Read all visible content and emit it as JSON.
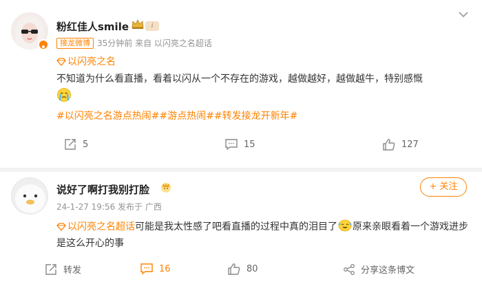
{
  "post1": {
    "username": "粉红佳人smile",
    "source_tag": "接龙微博",
    "time_source": "35分钟前   来自 以闪亮之名超话",
    "topic": "以闪亮之名",
    "text": "不知道为什么看直播，看着以闪从一个不存在的游戏，越做越好，越做越牛，特别感慨",
    "hashtags": "#以闪亮之名游点热闹##游点热闹##转发接龙开新年#",
    "actions": {
      "repost": "5",
      "comment": "15",
      "like": "127"
    }
  },
  "post2": {
    "username": "说好了啊打我别打脸",
    "time_source": "24-1-27 19:56  发布于 广西",
    "follow_label": "+ 关注",
    "comment": {
      "topic": "以闪亮之名超话",
      "text_before_emoji": "可能是我太性感了吧看直播的过程中真的泪目了",
      "text_after_emoji": "原来亲眼看着一个游戏进步是这么开心的事"
    },
    "actions": {
      "repost": "转发",
      "comment": "16",
      "like": "80",
      "share": "分享这条博文"
    }
  },
  "colors": {
    "accent": "#ff8200",
    "text": "#333333",
    "meta": "#939393"
  }
}
